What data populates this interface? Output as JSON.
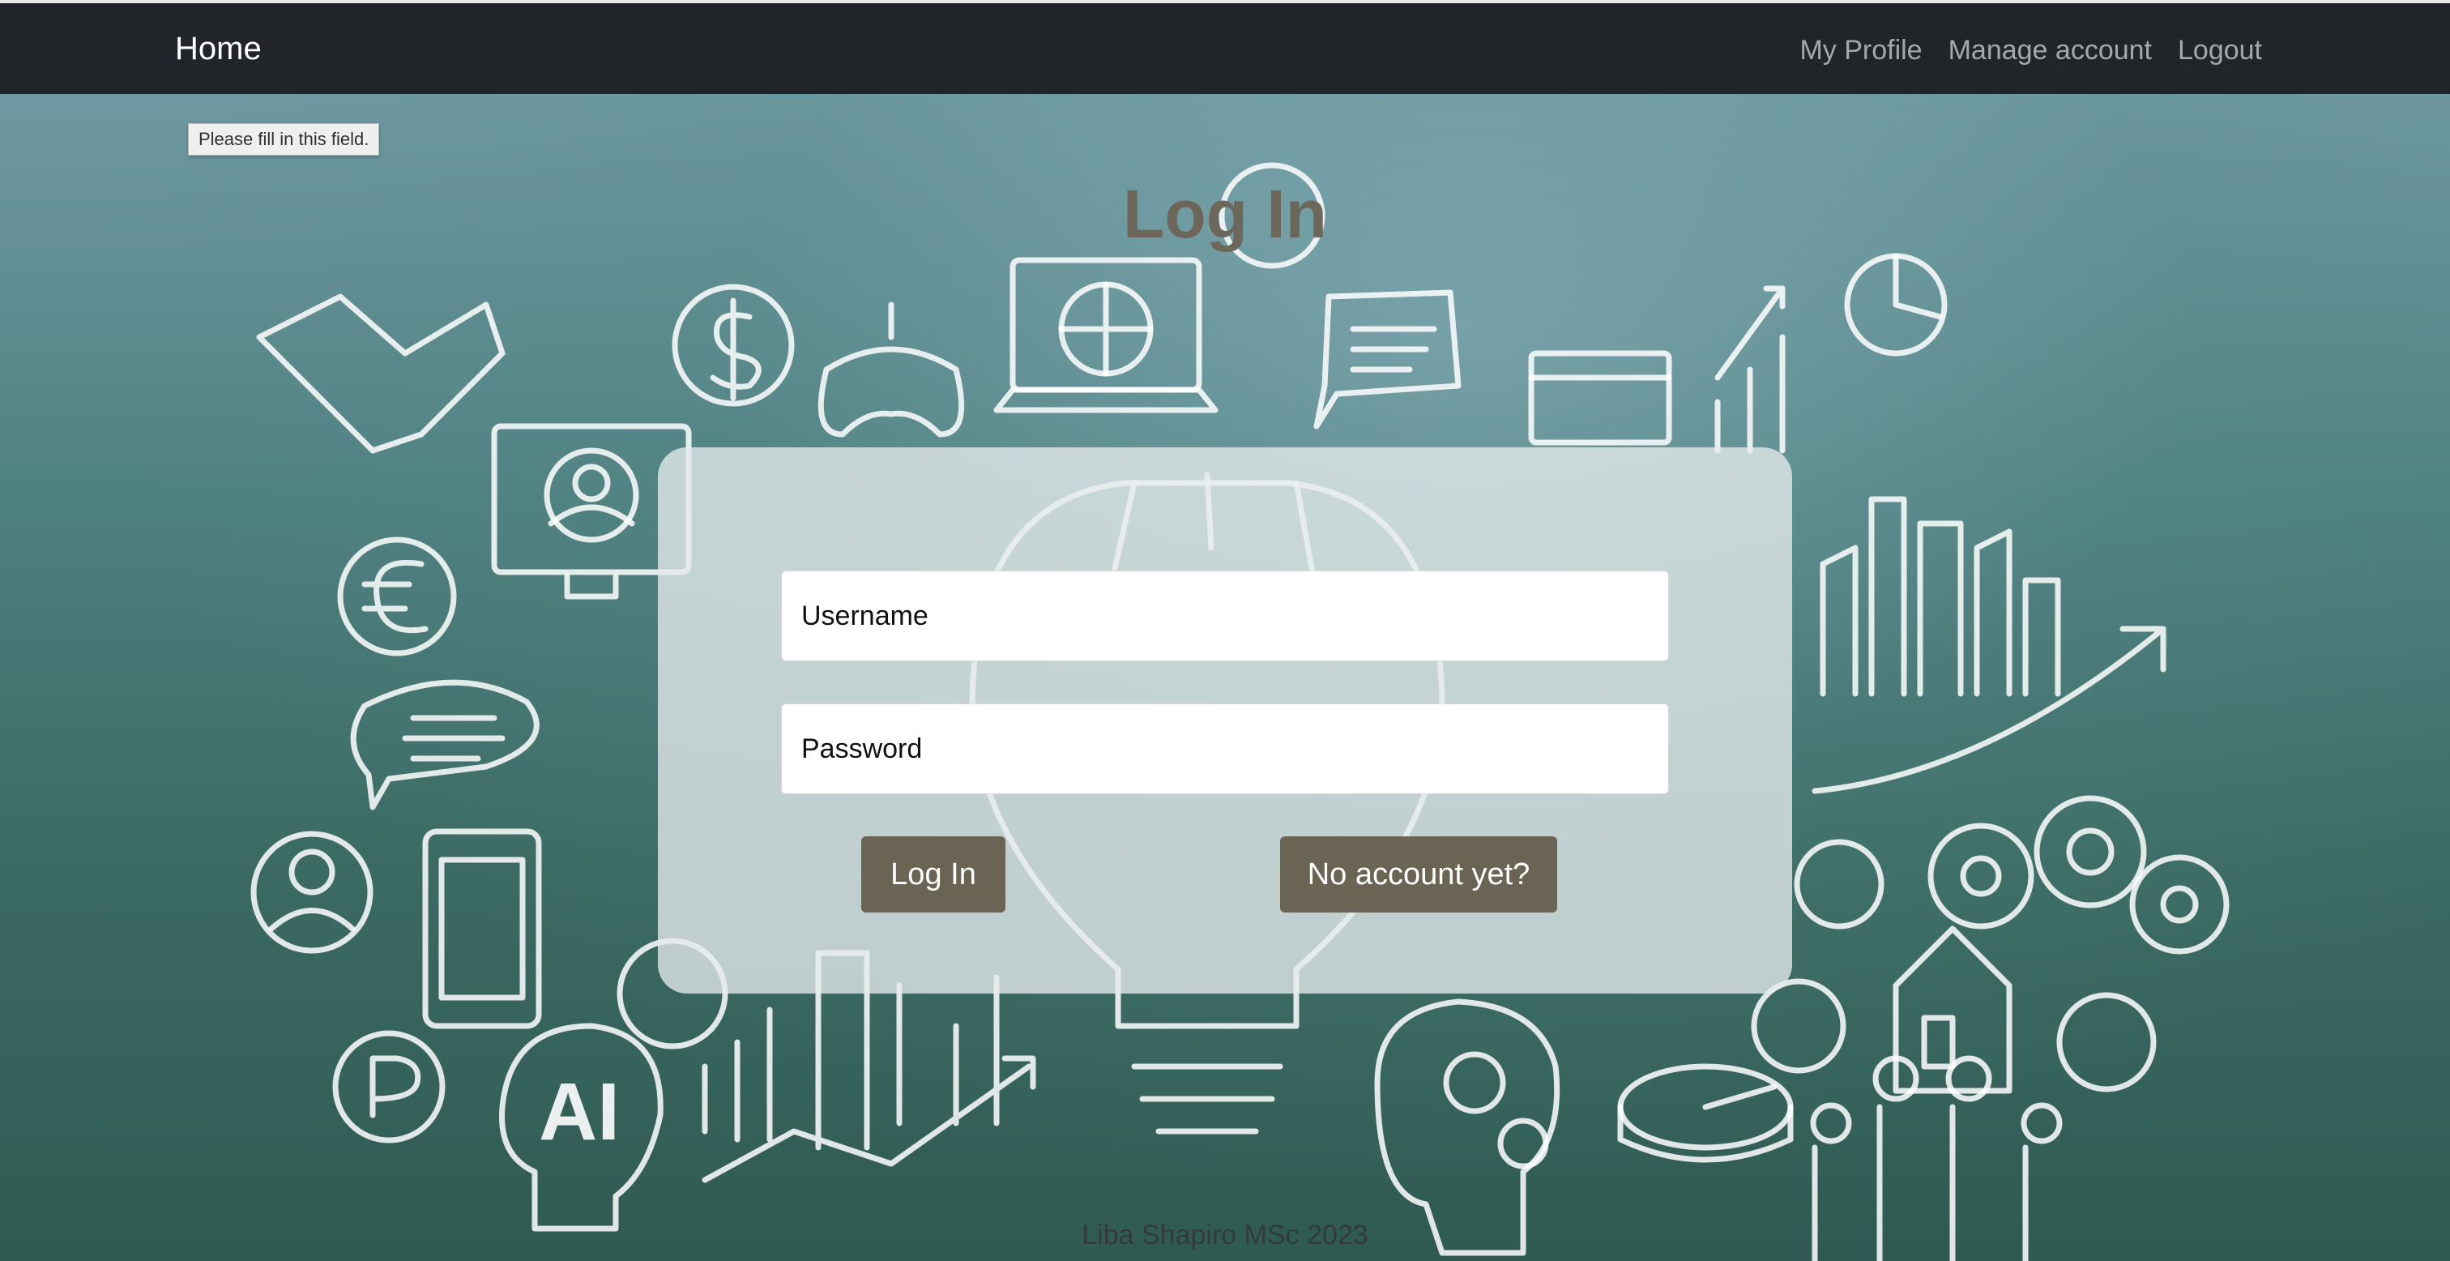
{
  "navbar": {
    "brand": "Home",
    "links": [
      "My Profile",
      "Manage account",
      "Logout"
    ]
  },
  "validation_tooltip": "Please fill in this field.",
  "page_title": "Log In",
  "form": {
    "username_placeholder": "Username",
    "password_placeholder": "Password",
    "login_button": "Log In",
    "signup_button": "No account yet?"
  },
  "footer": "Liba Shapiro MSc 2023",
  "colors": {
    "navbar_bg": "#212529",
    "button_bg": "#6b6454",
    "title": "#6d675b"
  }
}
